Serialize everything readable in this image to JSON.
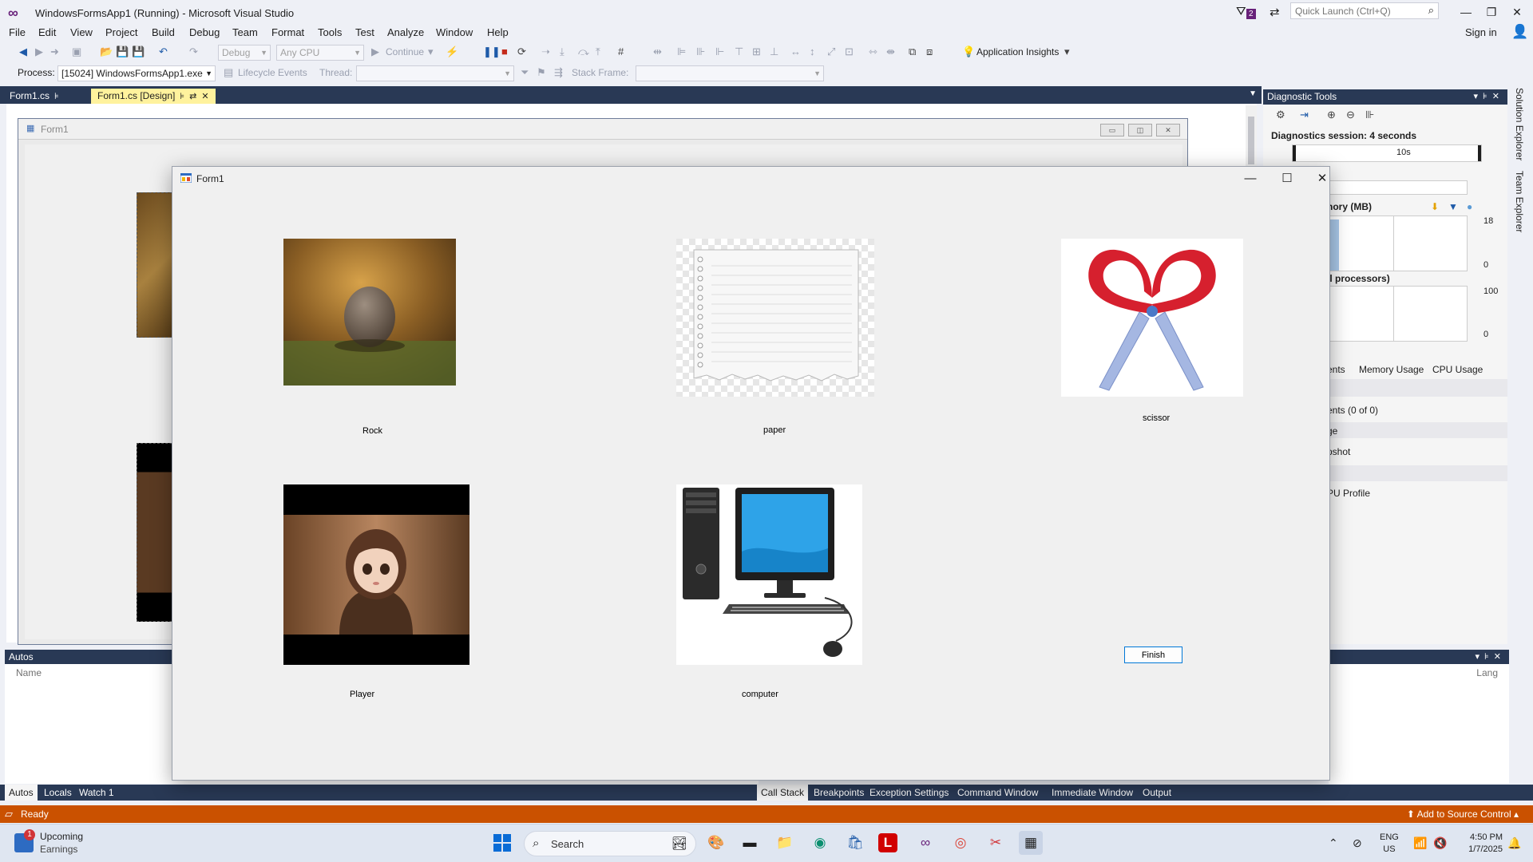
{
  "window": {
    "title": "WindowsFormsApp1 (Running) - Microsoft Visual Studio",
    "notification_count": "2",
    "quick_launch_placeholder": "Quick Launch (Ctrl+Q)",
    "sign_in": "Sign in"
  },
  "menu": [
    "File",
    "Edit",
    "View",
    "Project",
    "Build",
    "Debug",
    "Team",
    "Format",
    "Tools",
    "Test",
    "Analyze",
    "Window",
    "Help"
  ],
  "toolbar": {
    "configuration": "Debug",
    "platform": "Any CPU",
    "continue": "Continue",
    "application_insights": "Application Insights",
    "process_label": "Process:",
    "process_value": "[15024] WindowsFormsApp1.exe",
    "lifecycle_events": "Lifecycle Events",
    "thread_label": "Thread:",
    "stack_frame_label": "Stack Frame:"
  },
  "doc_tabs": [
    {
      "label": "Form1.cs",
      "active": false
    },
    {
      "label": "Form1.cs [Design]",
      "active": true
    }
  ],
  "designer": {
    "form_title": "Form1"
  },
  "diagnostic_tools": {
    "title": "Diagnostic Tools",
    "session": "Diagnostics session: 4 seconds",
    "timeline_label": "10s",
    "memory_label": "nory (MB)",
    "memory_max": "18",
    "memory_min": "0",
    "cpu_label": "ll processors)",
    "cpu_max": "100",
    "cpu_min": "0",
    "tabs": [
      "ents",
      "Memory Usage",
      "CPU Usage"
    ],
    "events": "ents (0 of 0)",
    "row_ge": "ge",
    "snapshot": "pshot",
    "cpu_profile": "PU Profile"
  },
  "side_tabs": [
    "Solution Explorer",
    "Team Explorer"
  ],
  "autos": {
    "title": "Autos",
    "col_name": "Name",
    "col_lang": "Lang"
  },
  "bottom_tabs_left": [
    {
      "label": "Autos",
      "active": true
    },
    {
      "label": "Locals",
      "active": false
    },
    {
      "label": "Watch 1",
      "active": false
    }
  ],
  "bottom_tabs_right": [
    {
      "label": "Call Stack",
      "active": true
    },
    {
      "label": "Breakpoints",
      "active": false
    },
    {
      "label": "Exception Settings",
      "active": false
    },
    {
      "label": "Command Window",
      "active": false
    },
    {
      "label": "Immediate Window",
      "active": false
    },
    {
      "label": "Output",
      "active": false
    }
  ],
  "status": {
    "ready": "Ready",
    "source_control": "Add to Source Control"
  },
  "form1": {
    "title": "Form1",
    "captions": {
      "rock": "Rock",
      "paper": "paper",
      "scissor": "scissor",
      "player": "Player",
      "computer": "computer"
    },
    "finish_button": "Finish"
  },
  "taskbar": {
    "weather_badge": "1",
    "weather_line1": "Upcoming",
    "weather_line2": "Earnings",
    "search": "Search",
    "lang_line1": "ENG",
    "lang_line2": "US",
    "time": "4:50 PM",
    "date": "1/7/2025"
  }
}
